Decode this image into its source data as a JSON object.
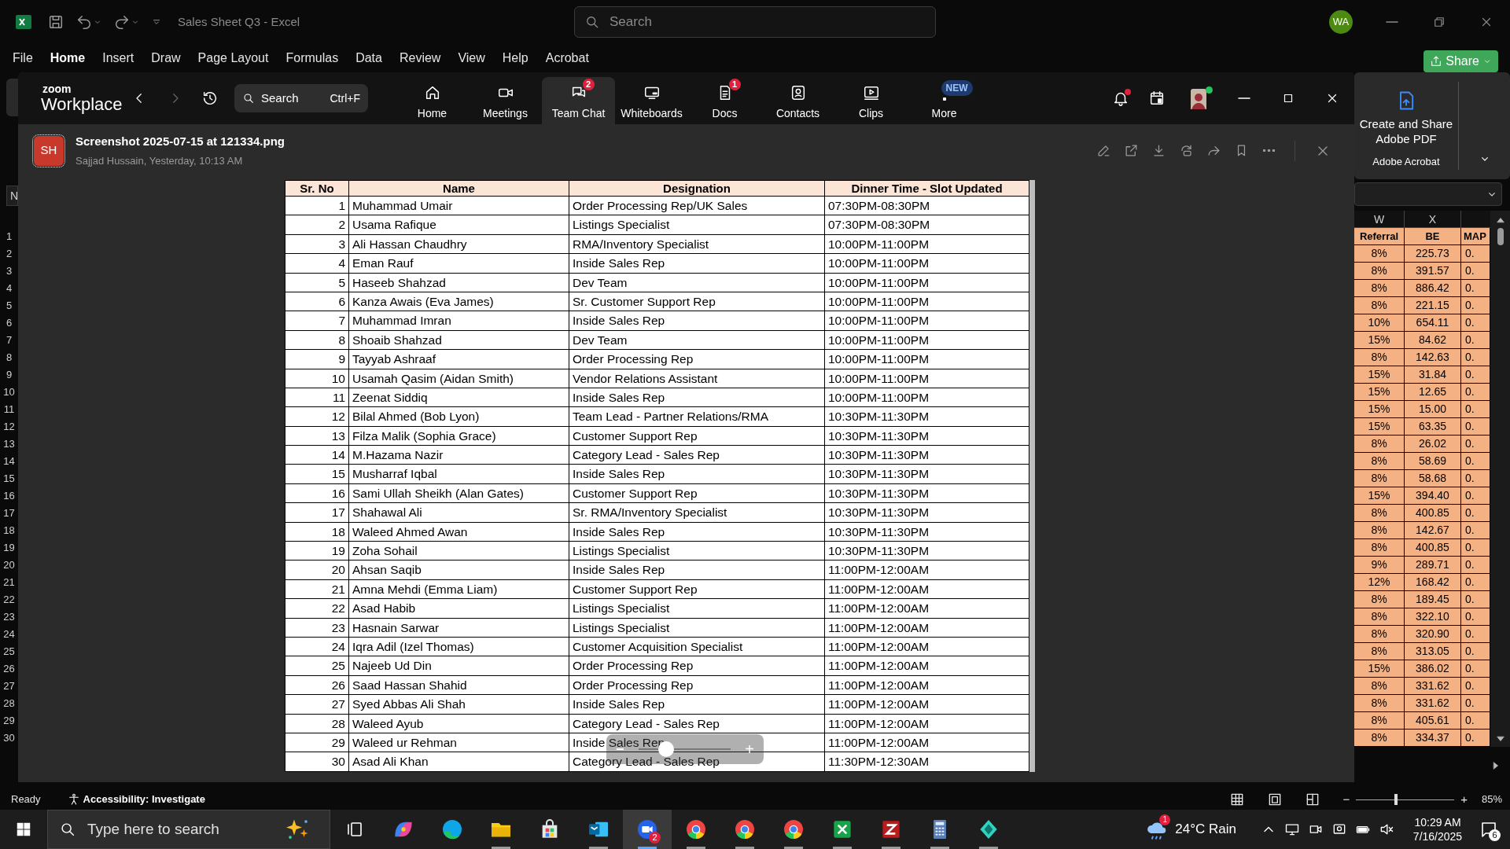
{
  "excel": {
    "title": "Sales Sheet Q3 - Excel",
    "search": {
      "placeholder": "Search"
    },
    "account": "WA",
    "menu": [
      {
        "label": "File",
        "selected": false
      },
      {
        "label": "Home",
        "selected": true
      },
      {
        "label": "Insert",
        "selected": false
      },
      {
        "label": "Draw",
        "selected": false
      },
      {
        "label": "Page Layout",
        "selected": false
      },
      {
        "label": "Formulas",
        "selected": false
      },
      {
        "label": "Data",
        "selected": false
      },
      {
        "label": "Review",
        "selected": false
      },
      {
        "label": "View",
        "selected": false
      },
      {
        "label": "Help",
        "selected": false
      },
      {
        "label": "Acrobat",
        "selected": false
      }
    ],
    "share": "Share",
    "ribbon": {
      "button": "Create and Share Adobe PDF",
      "group": "Adobe Acrobat"
    },
    "name_box": "N",
    "row_numbers": [
      "1",
      "2",
      "3",
      "4",
      "5",
      "6",
      "7",
      "8",
      "9",
      "10",
      "11",
      "12",
      "13",
      "14",
      "15",
      "16",
      "17",
      "18",
      "19",
      "20",
      "21",
      "22",
      "23",
      "24",
      "25",
      "26",
      "27",
      "28",
      "29",
      "30"
    ],
    "columns": [
      "W",
      "X"
    ],
    "header": [
      "Referral",
      "BE",
      "MAP"
    ],
    "rows": [
      [
        "8%",
        "225.73",
        "0."
      ],
      [
        "8%",
        "391.57",
        "0."
      ],
      [
        "8%",
        "886.42",
        "0."
      ],
      [
        "8%",
        "221.15",
        "0."
      ],
      [
        "10%",
        "654.11",
        "0."
      ],
      [
        "15%",
        "84.62",
        "0."
      ],
      [
        "8%",
        "142.63",
        "0."
      ],
      [
        "15%",
        "31.84",
        "0."
      ],
      [
        "15%",
        "12.65",
        "0."
      ],
      [
        "15%",
        "15.00",
        "0."
      ],
      [
        "15%",
        "63.35",
        "0."
      ],
      [
        "8%",
        "26.02",
        "0."
      ],
      [
        "8%",
        "58.69",
        "0."
      ],
      [
        "8%",
        "58.68",
        "0."
      ],
      [
        "15%",
        "394.40",
        "0."
      ],
      [
        "8%",
        "400.85",
        "0."
      ],
      [
        "8%",
        "142.67",
        "0."
      ],
      [
        "8%",
        "400.85",
        "0."
      ],
      [
        "9%",
        "289.71",
        "0."
      ],
      [
        "12%",
        "168.42",
        "0."
      ],
      [
        "8%",
        "189.45",
        "0."
      ],
      [
        "8%",
        "322.10",
        "0."
      ],
      [
        "8%",
        "320.90",
        "0."
      ],
      [
        "8%",
        "313.05",
        "0."
      ],
      [
        "15%",
        "386.02",
        "0."
      ],
      [
        "8%",
        "331.62",
        "0."
      ],
      [
        "8%",
        "331.62",
        "0."
      ],
      [
        "8%",
        "405.61",
        "0."
      ],
      [
        "8%",
        "334.37",
        "0."
      ]
    ],
    "status": {
      "ready": "Ready",
      "accessibility": "Accessibility: Investigate",
      "zoom": "85%",
      "zoom_slider": {
        "minus": "−",
        "plus": "+",
        "level": 0.4
      }
    }
  },
  "zoom_app": {
    "logo_small": "zoom",
    "logo": "Workplace",
    "search": {
      "placeholder": "Search",
      "shortcut": "Ctrl+F"
    },
    "nav": [
      {
        "label": "Home",
        "selected": false
      },
      {
        "label": "Meetings",
        "selected": false
      },
      {
        "label": "Team Chat",
        "selected": true,
        "badge": "2"
      },
      {
        "label": "Whiteboards",
        "selected": false
      },
      {
        "label": "Docs",
        "selected": false,
        "badge": "1"
      },
      {
        "label": "Contacts",
        "selected": false
      },
      {
        "label": "Clips",
        "selected": false
      },
      {
        "label": "More",
        "selected": false,
        "tag": "NEW"
      }
    ]
  },
  "viewer": {
    "avatar": "SH",
    "title": "Screenshot 2025-07-15 at 121334.png",
    "subtitle": "Sajjad Hussain, Yesterday, 10:13 AM",
    "zoom_slider": {
      "minus": "−",
      "plus": "+",
      "level": 0.3
    },
    "table": {
      "columns": [
        "Sr. No",
        "Name",
        "Designation",
        "Dinner Time - Slot Updated"
      ],
      "rows": [
        [
          "1",
          "Muhammad Umair",
          "Order Processing Rep/UK Sales",
          "07:30PM-08:30PM"
        ],
        [
          "2",
          "Usama Rafique",
          "Listings Specialist",
          "07:30PM-08:30PM"
        ],
        [
          "3",
          "Ali Hassan Chaudhry",
          "RMA/Inventory Specialist",
          "10:00PM-11:00PM"
        ],
        [
          "4",
          "Eman Rauf",
          "Inside Sales Rep",
          "10:00PM-11:00PM"
        ],
        [
          "5",
          "Haseeb Shahzad",
          "Dev Team",
          "10:00PM-11:00PM"
        ],
        [
          "6",
          "Kanza Awais (Eva James)",
          "Sr. Customer Support Rep",
          "10:00PM-11:00PM"
        ],
        [
          "7",
          "Muhammad Imran",
          "Inside Sales Rep",
          "10:00PM-11:00PM"
        ],
        [
          "8",
          "Shoaib Shahzad",
          "Dev Team",
          "10:00PM-11:00PM"
        ],
        [
          "9",
          "Tayyab Ashraaf",
          "Order Processing Rep",
          "10:00PM-11:00PM"
        ],
        [
          "10",
          "Usamah Qasim (Aidan Smith)",
          "Vendor Relations Assistant",
          "10:00PM-11:00PM"
        ],
        [
          "11",
          "Zeenat Siddiq",
          "Inside Sales Rep",
          "10:00PM-11:00PM"
        ],
        [
          "12",
          "Bilal Ahmed (Bob Lyon)",
          "Team Lead - Partner Relations/RMA",
          "10:30PM-11:30PM"
        ],
        [
          "13",
          "Filza Malik (Sophia Grace)",
          "Customer Support Rep",
          "10:30PM-11:30PM"
        ],
        [
          "14",
          "M.Hazama Nazir",
          "Category Lead - Sales Rep",
          "10:30PM-11:30PM"
        ],
        [
          "15",
          "Musharraf Iqbal",
          "Inside Sales Rep",
          "10:30PM-11:30PM"
        ],
        [
          "16",
          "Sami Ullah Sheikh (Alan Gates)",
          "Customer Support Rep",
          "10:30PM-11:30PM"
        ],
        [
          "17",
          "Shahawal Ali",
          "Sr. RMA/Inventory Specialist",
          "10:30PM-11:30PM"
        ],
        [
          "18",
          "Waleed Ahmed Awan",
          "Inside Sales Rep",
          "10:30PM-11:30PM"
        ],
        [
          "19",
          "Zoha Sohail",
          "Listings Specialist",
          "10:30PM-11:30PM"
        ],
        [
          "20",
          "Ahsan Saqib",
          "Inside Sales Rep",
          "11:00PM-12:00AM"
        ],
        [
          "21",
          "Amna Mehdi (Emma Liam)",
          "Customer Support Rep",
          "11:00PM-12:00AM"
        ],
        [
          "22",
          "Asad Habib",
          "Listings Specialist",
          "11:00PM-12:00AM"
        ],
        [
          "23",
          "Hasnain Sarwar",
          "Listings Specialist",
          "11:00PM-12:00AM"
        ],
        [
          "24",
          "Iqra Adil (Izel Thomas)",
          "Customer Acquisition Specialist",
          "11:00PM-12:00AM"
        ],
        [
          "25",
          "Najeeb Ud Din",
          "Order Processing Rep",
          "11:00PM-12:00AM"
        ],
        [
          "26",
          "Saad Hassan Shahid",
          "Order Processing Rep",
          "11:00PM-12:00AM"
        ],
        [
          "27",
          "Syed Abbas Ali Shah",
          "Inside Sales Rep",
          "11:00PM-12:00AM"
        ],
        [
          "28",
          "Waleed Ayub",
          "Category Lead - Sales Rep",
          "11:00PM-12:00AM"
        ],
        [
          "29",
          "Waleed ur Rehman",
          "Inside Sales Rep",
          "11:00PM-12:00AM"
        ],
        [
          "30",
          "Asad Ali Khan",
          "Category Lead - Sales Rep",
          "11:30PM-12:30AM"
        ]
      ]
    }
  },
  "taskbar": {
    "search": {
      "placeholder": "Type here to search"
    },
    "apps": [
      {
        "running": false,
        "selected": false
      },
      {
        "running": false,
        "selected": false
      },
      {
        "running": true,
        "selected": false
      },
      {
        "running": false,
        "selected": false
      },
      {
        "running": true,
        "selected": false
      },
      {
        "running": true,
        "selected": true,
        "badge": "2"
      },
      {
        "running": true,
        "selected": false
      },
      {
        "running": true,
        "selected": false
      },
      {
        "running": true,
        "selected": false
      },
      {
        "running": true,
        "selected": false
      },
      {
        "running": true,
        "selected": false
      },
      {
        "running": true,
        "selected": false
      },
      {
        "running": true,
        "selected": false
      }
    ],
    "weather": {
      "badge": "1",
      "text": "24°C Rain"
    },
    "time": "10:29 AM",
    "date": "7/16/2025",
    "notifications": "6"
  }
}
